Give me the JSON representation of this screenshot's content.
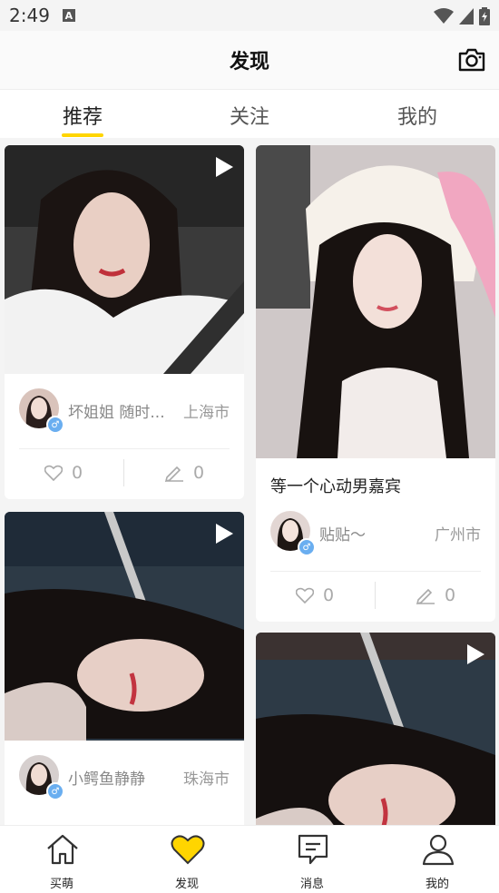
{
  "status": {
    "time": "2:49",
    "notification_icon": "A"
  },
  "header": {
    "title": "发现",
    "camera_icon": "camera-icon"
  },
  "tabs": [
    {
      "label": "推荐",
      "active": true
    },
    {
      "label": "关注",
      "active": false
    },
    {
      "label": "我的",
      "active": false
    }
  ],
  "feed": {
    "cards": [
      {
        "user": "坏姐姐 随时...",
        "city": "上海市",
        "likes": "0",
        "comments": "0",
        "caption": "",
        "video": true
      },
      {
        "user": "贴贴～",
        "city": "广州市",
        "likes": "0",
        "comments": "0",
        "caption": "等一个心动男嘉宾",
        "video": false
      },
      {
        "user": "小鳄鱼静静",
        "city": "珠海市",
        "likes": "",
        "comments": "",
        "caption": "",
        "video": true
      },
      {
        "user": "",
        "city": "",
        "likes": "",
        "comments": "",
        "caption": "",
        "video": true
      }
    ]
  },
  "bottom_nav": [
    {
      "label": "买萌",
      "icon": "home-icon",
      "active": false
    },
    {
      "label": "发现",
      "icon": "heart-icon",
      "active": true
    },
    {
      "label": "消息",
      "icon": "message-icon",
      "active": false
    },
    {
      "label": "我的",
      "icon": "user-icon",
      "active": false
    }
  ],
  "colors": {
    "accent": "#ffd500",
    "gender_badge": "#6aaef0"
  }
}
